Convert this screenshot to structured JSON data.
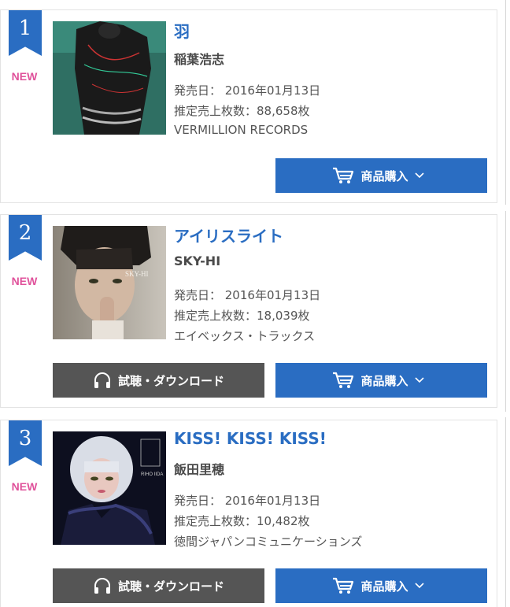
{
  "actions": {
    "buy_label": "商品購入",
    "dl_label": "試聴・ダウンロード"
  },
  "items": [
    {
      "rank": "1",
      "badge": "NEW",
      "title": "羽",
      "artist": "稲葉浩志",
      "release": "発売日： 2016年01月13日",
      "sales": "推定売上枚数：88,658枚",
      "label": "VERMILLION RECORDS",
      "has_download": false
    },
    {
      "rank": "2",
      "badge": "NEW",
      "title": "アイリスライト",
      "artist": "SKY-HI",
      "release": "発売日： 2016年01月13日",
      "sales": "推定売上枚数：18,039枚",
      "label": "エイベックス・トラックス",
      "cover_text": "SKY-HI",
      "has_download": true
    },
    {
      "rank": "3",
      "badge": "NEW",
      "title": "KISS! KISS! KISS!",
      "artist": "飯田里穂",
      "release": "発売日： 2016年01月13日",
      "sales": "推定売上枚数：10,482枚",
      "label": "徳間ジャパンコミュニケーションズ",
      "cover_text": "RIHO IIDA",
      "has_download": true
    }
  ]
}
